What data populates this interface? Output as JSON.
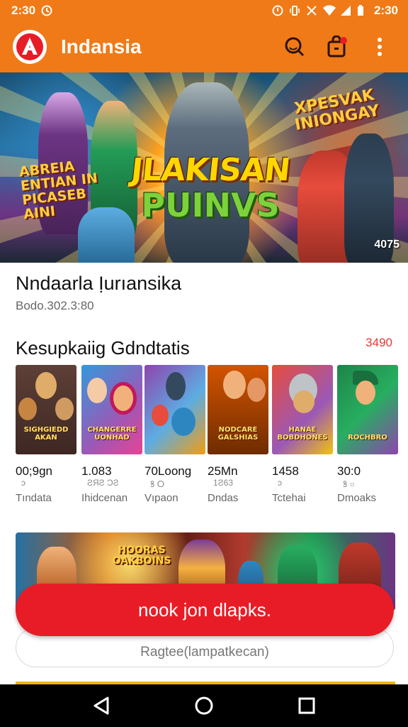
{
  "status_bar": {
    "time": "2:30",
    "clock_text": "2:30",
    "right_text": "2:30",
    "icons": [
      "alarm-icon",
      "vibrate-icon",
      "wifi-icon",
      "signal-icon",
      "battery-icon"
    ]
  },
  "app": {
    "title": "Indansia",
    "logo_letter": "A",
    "actions": [
      "search-icon",
      "shop-bag-icon",
      "more-vert-icon"
    ],
    "accent": "#f07a17"
  },
  "hero": {
    "title_line1": "JLAKISAN",
    "title_line2": "PUINVS",
    "sub_left": "ABREIA ENTIAN IN PICASEB AINI",
    "sub_right": "XPESVAK INIONGAY",
    "counter": "4075"
  },
  "game": {
    "title": "Nndaarla Ịurıansika",
    "id": "Bodo.302.3:80"
  },
  "section": {
    "title": "Kesupkaiig Gdndtatis",
    "more": "3490"
  },
  "cards": [
    {
      "label": "SIGHGIEDD AKAN",
      "stat": "00;9gn",
      "sub": "ↄ",
      "name": "Tındata"
    },
    {
      "label": "CHANGERRE UONHAD",
      "stat": "1.083",
      "sub": "ƧЯƧ ƆƧ",
      "name": "Ihidcenan"
    },
    {
      "label": "",
      "stat": "70Loong",
      "sub": "ꝸ  ⵔ",
      "name": "Vıpaon"
    },
    {
      "label": "NODCARE GALSHIAS",
      "stat": "25Mn",
      "sub": "1Ƨ63",
      "name": "Dndas"
    },
    {
      "label": "HANAE BOBDHONES",
      "stat": "1458",
      "sub": "ɔ",
      "name": "Tctehai"
    },
    {
      "label": "ROCHBRO",
      "stat": "30:0",
      "sub": "ꝸ  ○",
      "name": "Dmoaks"
    }
  ],
  "promo": {
    "label": "HOORAS OAKBOINS"
  },
  "join_button": "nook jon dlapks.",
  "secondary_field": "Ragtee(lampatkecan)",
  "nav": [
    "back-icon",
    "home-icon",
    "recents-icon"
  ]
}
